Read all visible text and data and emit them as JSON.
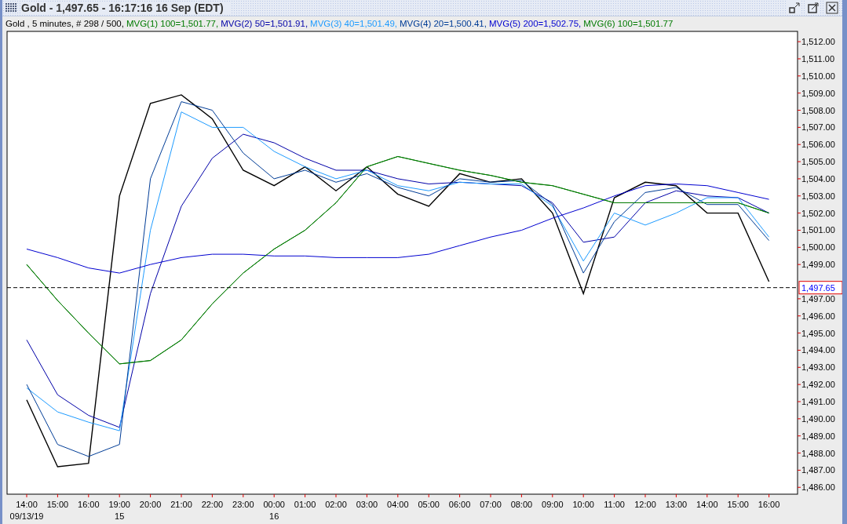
{
  "window": {
    "title": "Gold - 1,497.65 - 16:17:16  16 Sep (EDT)"
  },
  "chart_data": {
    "type": "line",
    "categories": [
      "14:00",
      "15:00",
      "16:00",
      "19:00",
      "20:00",
      "21:00",
      "22:00",
      "23:00",
      "00:00",
      "01:00",
      "02:00",
      "03:00",
      "04:00",
      "05:00",
      "06:00",
      "07:00",
      "08:00",
      "09:00",
      "10:00",
      "11:00",
      "12:00",
      "13:00",
      "14:00",
      "15:00",
      "16:00"
    ],
    "series": [
      {
        "name": "Gold , 5 minutes, # 298 / 500,",
        "color": "#000000",
        "values": [
          1491.1,
          1487.2,
          1487.4,
          1503.0,
          1508.4,
          1508.9,
          1507.5,
          1504.5,
          1503.6,
          1504.7,
          1503.3,
          1504.7,
          1503.1,
          1502.4,
          1504.3,
          1503.8,
          1504.0,
          1502.0,
          1497.3,
          1502.9,
          1503.8,
          1503.6,
          1502.0,
          1502.0,
          1498.0
        ]
      },
      {
        "name": "MVG(1) 100=1,501.77,",
        "color": "#007a00",
        "values": [
          1499.0,
          1496.9,
          1495.0,
          1493.2,
          1493.4,
          1494.6,
          1496.7,
          1498.5,
          1499.9,
          1501.0,
          1502.6,
          1504.7,
          1505.3,
          1504.9,
          1504.5,
          1504.2,
          1503.8,
          1503.6,
          1503.1,
          1502.6,
          1502.6,
          1502.6,
          1502.6,
          1502.6,
          1502.0
        ]
      },
      {
        "name": "MVG(2) 50=1,501.91,",
        "color": "#0000a8",
        "values": [
          1494.6,
          1491.4,
          1490.2,
          1489.5,
          1497.3,
          1502.4,
          1505.2,
          1506.6,
          1506.1,
          1505.2,
          1504.5,
          1504.5,
          1504.0,
          1503.7,
          1503.8,
          1503.7,
          1503.6,
          1502.6,
          1500.3,
          1500.6,
          1502.6,
          1503.3,
          1503.0,
          1502.9,
          1502.0
        ]
      },
      {
        "name": "MVG(3) 40=1,501.49,",
        "color": "#1e9bff",
        "values": [
          1491.8,
          1490.4,
          1489.8,
          1489.3,
          1501.0,
          1507.9,
          1507.0,
          1507.0,
          1505.6,
          1504.7,
          1504.0,
          1504.5,
          1503.6,
          1503.3,
          1503.8,
          1503.7,
          1503.7,
          1502.4,
          1499.2,
          1502.0,
          1501.3,
          1502.0,
          1502.9,
          1502.9,
          1500.6
        ]
      },
      {
        "name": "MVG(4) 20=1,500.41,",
        "color": "#003c96",
        "values": [
          1492.0,
          1488.5,
          1487.8,
          1488.5,
          1504.0,
          1508.5,
          1508.0,
          1505.5,
          1504.0,
          1504.5,
          1503.8,
          1504.3,
          1503.5,
          1503.0,
          1504.0,
          1503.8,
          1503.9,
          1502.5,
          1498.5,
          1501.5,
          1503.2,
          1503.5,
          1502.5,
          1502.5,
          1500.4
        ]
      },
      {
        "name": "MVG(5) 200=1,502.75,",
        "color": "#0000d0",
        "values": [
          1499.9,
          1499.4,
          1498.8,
          1498.5,
          1499.0,
          1499.4,
          1499.6,
          1499.6,
          1499.5,
          1499.5,
          1499.4,
          1499.4,
          1499.4,
          1499.6,
          1500.1,
          1500.6,
          1501.0,
          1501.7,
          1502.3,
          1503.0,
          1503.6,
          1503.7,
          1503.6,
          1503.2,
          1502.8
        ]
      },
      {
        "name": "MVG(6) 100=1,501.77",
        "color": "#007a00",
        "values": [
          1499.0,
          1496.9,
          1495.0,
          1493.2,
          1493.4,
          1494.6,
          1496.7,
          1498.5,
          1499.9,
          1501.0,
          1502.6,
          1504.7,
          1505.3,
          1504.9,
          1504.5,
          1504.2,
          1503.8,
          1503.6,
          1503.1,
          1502.6,
          1502.6,
          1502.6,
          1502.6,
          1502.6,
          1502.0
        ]
      }
    ],
    "ylim": [
      1485.6,
      1512.6
    ],
    "yticks": [
      {
        "value": 1486,
        "label": "1,486.00"
      },
      {
        "value": 1487,
        "label": "1,487.00"
      },
      {
        "value": 1488,
        "label": "1,488.00"
      },
      {
        "value": 1489,
        "label": "1,489.00"
      },
      {
        "value": 1490,
        "label": "1,490.00"
      },
      {
        "value": 1491,
        "label": "1,491.00"
      },
      {
        "value": 1492,
        "label": "1,492.00"
      },
      {
        "value": 1493,
        "label": "1,493.00"
      },
      {
        "value": 1494,
        "label": "1,494.00"
      },
      {
        "value": 1495,
        "label": "1,495.00"
      },
      {
        "value": 1496,
        "label": "1,496.00"
      },
      {
        "value": 1497,
        "label": "1,497.00"
      },
      {
        "value": 1499,
        "label": "1,499.00"
      },
      {
        "value": 1500,
        "label": "1,500.00"
      },
      {
        "value": 1501,
        "label": "1,501.00"
      },
      {
        "value": 1502,
        "label": "1,502.00"
      },
      {
        "value": 1503,
        "label": "1,503.00"
      },
      {
        "value": 1504,
        "label": "1,504.00"
      },
      {
        "value": 1505,
        "label": "1,505.00"
      },
      {
        "value": 1506,
        "label": "1,506.00"
      },
      {
        "value": 1507,
        "label": "1,507.00"
      },
      {
        "value": 1508,
        "label": "1,508.00"
      },
      {
        "value": 1509,
        "label": "1,509.00"
      },
      {
        "value": 1510,
        "label": "1,510.00"
      },
      {
        "value": 1511,
        "label": "1,511.00"
      },
      {
        "value": 1512,
        "label": "1,512.00"
      }
    ],
    "ref_lines": [
      {
        "axis": "y",
        "value": 1497.65,
        "label": "1,497.65"
      }
    ]
  },
  "date_row": [
    "09/13/19",
    "15",
    "16"
  ]
}
